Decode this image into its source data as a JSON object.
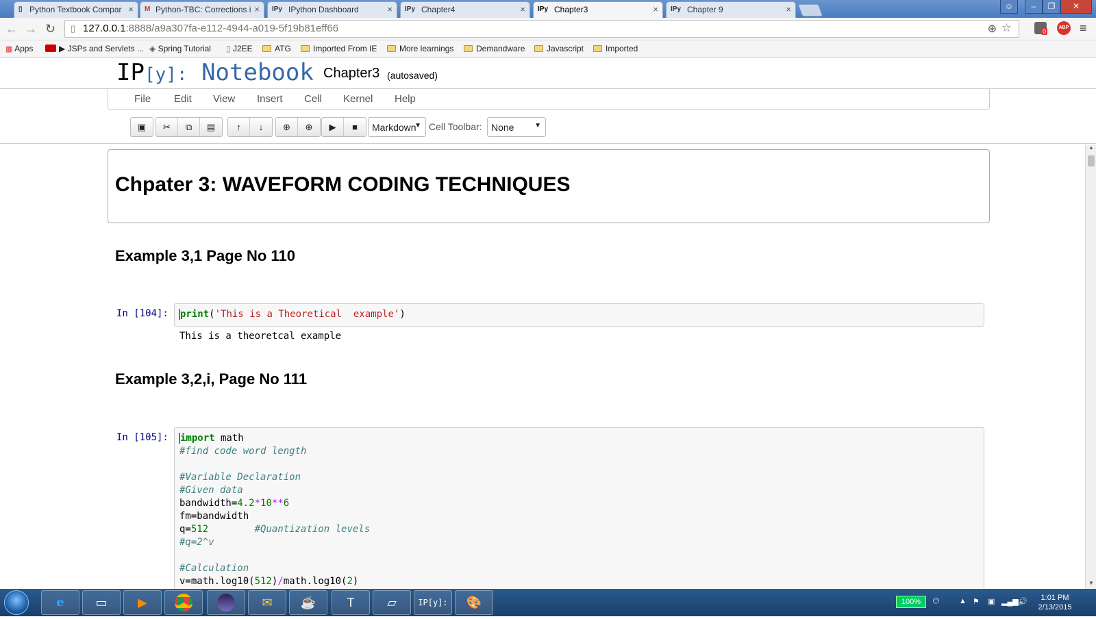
{
  "browser": {
    "tabs": [
      {
        "favicon": "doc-icon",
        "label": "Python Textbook Compar"
      },
      {
        "favicon": "gmail-icon",
        "label": "Python-TBC: Corrections i"
      },
      {
        "favicon": "IPy",
        "label": "IPython Dashboard"
      },
      {
        "favicon": "IPy",
        "label": "Chapter4"
      },
      {
        "favicon": "IPy",
        "label": "Chapter3"
      },
      {
        "favicon": "IPy",
        "label": "Chapter 9"
      }
    ],
    "url_host": "127.0.0.1",
    "url_rest": ":8888/a9a307fa-e112-4944-a019-5f19b81eff66",
    "bookmarks": [
      "Apps",
      "JSPs and Servlets ...",
      "Spring Tutorial",
      "J2EE",
      "ATG",
      "Imported From IE",
      "More learnings",
      "Demandware",
      "Javascript",
      "Imported"
    ],
    "extension_badge": "0",
    "abp_label": "ABP"
  },
  "notebook": {
    "logo_ip": "IP",
    "logo_bracket": "[y]:",
    "logo_notebook": "Notebook",
    "title": "Chapter3",
    "autosave": "(autosaved)",
    "menu": [
      "File",
      "Edit",
      "View",
      "Insert",
      "Cell",
      "Kernel",
      "Help"
    ],
    "cell_type": "Markdown",
    "cell_toolbar_label": "Cell Toolbar:",
    "cell_toolbar_value": "None"
  },
  "cells": {
    "heading1": "Chpater 3: WAVEFORM CODING TECHNIQUES",
    "heading2a": "Example 3,1 Page No 110",
    "prompt1": "In [104]:",
    "code1_fn": "print",
    "code1_str": "'This is a Theoretical  example'",
    "output1": "This is a theoretcal example",
    "heading2b": "Example 3,2,i, Page No 111",
    "prompt2": "In [105]:",
    "code2": {
      "l1_kw": "import",
      "l1_rest": " math",
      "l2": "#find code word length",
      "l4": "#Variable Declaration",
      "l5": "#Given data",
      "l6_a": "bandwidth=",
      "l6_b": "4.2",
      "l6_c": "*",
      "l6_d": "10",
      "l6_e": "**",
      "l6_f": "6",
      "l7": "fm=bandwidth",
      "l8_a": "q=",
      "l8_b": "512",
      "l8_c": "#Quantization levels",
      "l9": "#q=2^v",
      "l11": "#Calculation",
      "l12_a": "v=math.log10(",
      "l12_b": "512",
      "l12_c": ")",
      "l12_d": "/",
      "l12_e": "math.log10(",
      "l12_f": "2",
      "l12_g": ")"
    }
  },
  "taskbar": {
    "battery": "100%",
    "time": "1:01 PM",
    "date": "2/13/2015"
  }
}
